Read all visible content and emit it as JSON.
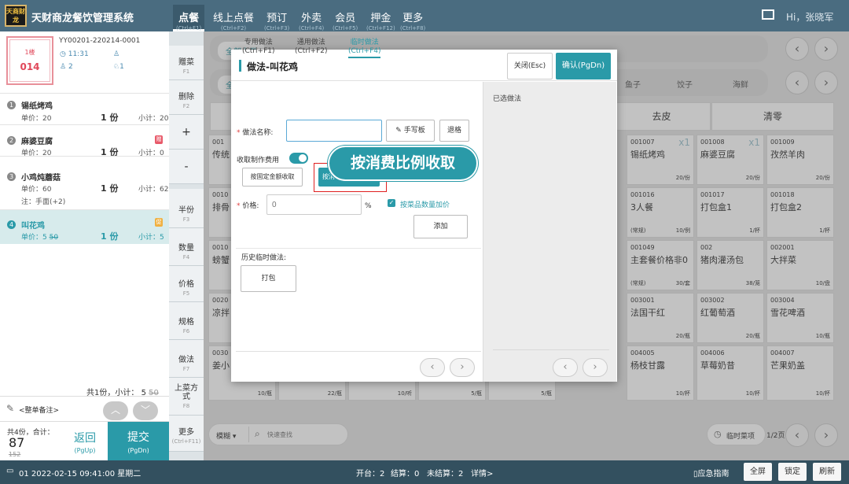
{
  "app": {
    "logo_text": "天商财龙",
    "title": "天财商龙餐饮管理系统"
  },
  "nav": [
    {
      "label": "点餐",
      "shortcut": "(Ctrl+F1)"
    },
    {
      "label": "线上点餐",
      "shortcut": "(Ctrl+F2)"
    },
    {
      "label": "预订",
      "shortcut": "(Ctrl+F3)"
    },
    {
      "label": "外卖",
      "shortcut": "(Ctrl+F4)"
    },
    {
      "label": "会员",
      "shortcut": "(Ctrl+F5)"
    },
    {
      "label": "押金",
      "shortcut": "(Ctrl+F12)"
    },
    {
      "label": "更多",
      "shortcut": "(Ctrl+F8)"
    }
  ],
  "user": {
    "greeting": "Hi，张晓军"
  },
  "order": {
    "table_floor": "1楼",
    "table_no": "014",
    "order_no": "YY00201-220214-0001",
    "time": "11:31",
    "guests": "2",
    "waiter": "1",
    "items": [
      {
        "no": "1",
        "name": "锡纸烤鸡",
        "price": "单价：20",
        "qty": "1 份",
        "subtotal": "小计：20"
      },
      {
        "no": "2",
        "name": "麻婆豆腐",
        "price": "单价：20",
        "qty": "1 份",
        "subtotal": "小计：0",
        "tag": "赠"
      },
      {
        "no": "3",
        "name": "小鸡炖蘑菇",
        "price": "单价：60",
        "qty": "1 份",
        "subtotal": "小计：62",
        "note": "注：手面(+2)"
      },
      {
        "no": "4",
        "name": "叫花鸡",
        "price": "单价：5",
        "price_orig": "50",
        "qty": "1 份",
        "subtotal": "小计：5",
        "tag": "促"
      }
    ],
    "summary": "共1份，小计：",
    "summary_amt": "5",
    "summary_orig": "50",
    "note_label": "<整单备注>",
    "total_label": "共4份，合计：",
    "total": "87",
    "total_orig": "152",
    "back_label": "返回",
    "back_key": "(PgUp)",
    "submit_label": "提交",
    "submit_key": "(PgDn)"
  },
  "sidebar": [
    {
      "label": "赠菜",
      "key": "F1"
    },
    {
      "label": "删除",
      "key": "F2"
    },
    {
      "label": "+",
      "key": ""
    },
    {
      "label": "-",
      "key": ""
    },
    {
      "label": "半份",
      "key": "F3"
    },
    {
      "label": "数量",
      "key": "F4"
    },
    {
      "label": "价格",
      "key": "F5"
    },
    {
      "label": "规格",
      "key": "F6"
    },
    {
      "label": "做法",
      "key": "F7"
    },
    {
      "label": "上菜方式",
      "key": "F8"
    },
    {
      "label": "更多",
      "key": "(Ctrl+F11)"
    }
  ],
  "categories": {
    "row1_first": "全部大类",
    "row2_first": "全",
    "row2_items": [
      "饺子",
      "海鲜"
    ],
    "row2_partial": "鱼子"
  },
  "actions": [
    "去皮",
    "清零"
  ],
  "dishes": [
    {
      "code": "001",
      "name": "传统"
    },
    {
      "code": "001007",
      "name": "锡纸烤鸡",
      "spec": "20/份",
      "mult": "x1"
    },
    {
      "code": "001008",
      "name": "麻婆豆腐",
      "spec": "20/份",
      "mult": "x1"
    },
    {
      "code": "001009",
      "name": "孜然羊肉",
      "spec": "20/份"
    },
    {
      "code": "0010",
      "name": "排骨"
    },
    {
      "code": "001016",
      "name": "3人餐",
      "mode": "(常规)",
      "spec": "10/例"
    },
    {
      "code": "001017",
      "name": "打包盒1",
      "spec": "1/杯"
    },
    {
      "code": "001018",
      "name": "打包盒2",
      "spec": "1/杯"
    },
    {
      "code": "0010",
      "name": "螃蟹"
    },
    {
      "code": "001049",
      "name": "主套餐价格非0",
      "mode": "(常规)",
      "spec": "30/套"
    },
    {
      "code": "002",
      "name": "猪肉灌汤包",
      "spec": "38/笼"
    },
    {
      "code": "002001",
      "name": "大拌菜",
      "spec": "10/盘"
    },
    {
      "code": "0020",
      "name": "凉拌"
    },
    {
      "code": "003001",
      "name": "法国干红",
      "spec": "20/瓶"
    },
    {
      "code": "003002",
      "name": "红葡萄酒",
      "spec": "20/瓶"
    },
    {
      "code": "003004",
      "name": "雪花啤酒",
      "spec": "10/瓶"
    },
    {
      "code": "0030",
      "name": "姜小"
    },
    {
      "code": "004005",
      "name": "杨枝甘露",
      "spec": "10/杯"
    },
    {
      "code": "004006",
      "name": "草莓奶昔",
      "spec": "10/杯"
    },
    {
      "code": "004007",
      "name": "芒果奶盖",
      "spec": "10/杯"
    }
  ],
  "bottom_row_specs": [
    "10/瓶",
    "22/瓶",
    "10/听",
    "5/瓶",
    "5/瓶"
  ],
  "search": {
    "mode": "模糊",
    "placeholder": "快速查找"
  },
  "temp_dish_label": "临时菜项",
  "page_label": "1/2页",
  "dialog": {
    "title": "做法-叫花鸡",
    "close_label": "关闭(Esc)",
    "confirm_label": "确认(PgDn)",
    "tabs": [
      {
        "label": "专用做法",
        "key": "(Ctrl+F1)"
      },
      {
        "label": "通用做法",
        "key": "(Ctrl+F2)"
      },
      {
        "label": "临时做法",
        "key": "(Ctrl+F4)"
      }
    ],
    "name_label": "做法名称:",
    "handwrite_label": "手写板",
    "backspace_label": "退格",
    "fee_label": "收取制作费用",
    "fixed_label": "按固定金额收取",
    "ratio_label": "按消",
    "price_label": "价格:",
    "price_placeholder": "0",
    "price_unit": "%",
    "by_qty_label": "按菜品数量加价",
    "add_label": "添加",
    "history_label": "历史临时做法:",
    "history_items": [
      "打包"
    ],
    "selected_label": "已选做法"
  },
  "tooltip": "按消费比例收取",
  "status": {
    "terminal": "01 2022-02-15 09:41:00 星期二",
    "open": "开台：2",
    "settled": "结算：0",
    "unsettled": "未结算：2",
    "details": "详情>",
    "guide": "应急指南",
    "fullscreen": "全屏",
    "lock": "锁定",
    "refresh": "刷新"
  }
}
